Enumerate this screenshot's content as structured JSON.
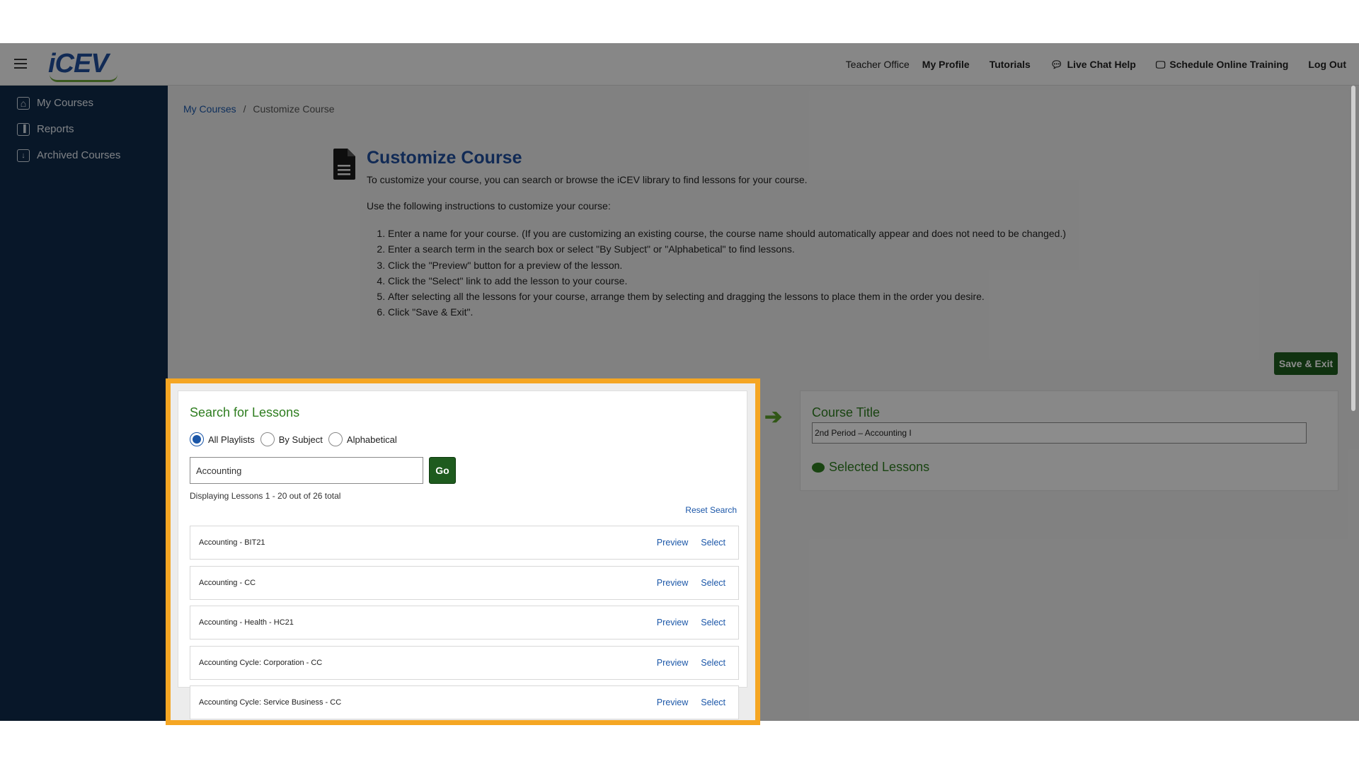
{
  "header": {
    "logo": "iCEV",
    "nav": {
      "teacher_office": "Teacher Office",
      "my_profile": "My Profile",
      "tutorials": "Tutorials",
      "live_chat": "Live Chat Help",
      "schedule": "Schedule Online Training",
      "logout": "Log Out"
    }
  },
  "sidebar": {
    "items": [
      {
        "label": "My Courses",
        "icon": "home-icon"
      },
      {
        "label": "Reports",
        "icon": "reports-icon"
      },
      {
        "label": "Archived Courses",
        "icon": "archive-icon"
      }
    ]
  },
  "breadcrumb": {
    "root": "My Courses",
    "separator": "/",
    "current": "Customize Course"
  },
  "page": {
    "title": "Customize Course",
    "intro": "To customize your course, you can search or browse the iCEV library to find lessons for your course.",
    "instructions_intro": "Use the following instructions to customize your course:",
    "steps": [
      "Enter a name for your course. (If you are customizing an existing course, the course name should automatically appear and does not need to be changed.)",
      "Enter a search term in the search box or select \"By Subject\" or \"Alphabetical\" to find lessons.",
      "Click the \"Preview\" button for a preview of the lesson.",
      "Click the \"Select\" link to add the lesson to your course.",
      "After selecting all the lessons for your course, arrange them by selecting and dragging the lessons to place them in the order you desire.",
      "Click \"Save & Exit\"."
    ],
    "save_label": "Save & Exit"
  },
  "search": {
    "title": "Search for Lessons",
    "radios": [
      {
        "label": "All Playlists",
        "checked": true
      },
      {
        "label": "By Subject",
        "checked": false
      },
      {
        "label": "Alphabetical",
        "checked": false
      }
    ],
    "query": "Accounting",
    "go_label": "Go",
    "display_text": "Displaying Lessons 1 - 20 out of 26 total",
    "reset_label": "Reset Search",
    "preview_label": "Preview",
    "select_label": "Select",
    "results": [
      "Accounting - BIT21",
      "Accounting - CC",
      "Accounting - Health - HC21",
      "Accounting Cycle: Corporation - CC",
      "Accounting Cycle: Service Business - CC"
    ]
  },
  "course": {
    "title_label": "Course Title",
    "title_value": "2nd Period – Accounting I",
    "selected_label": "Selected Lessons"
  },
  "colors": {
    "highlight": "#f5a623",
    "brand_blue": "#1f4e9c",
    "brand_green": "#2e7d1f",
    "sidebar": "#0f2a4a"
  }
}
